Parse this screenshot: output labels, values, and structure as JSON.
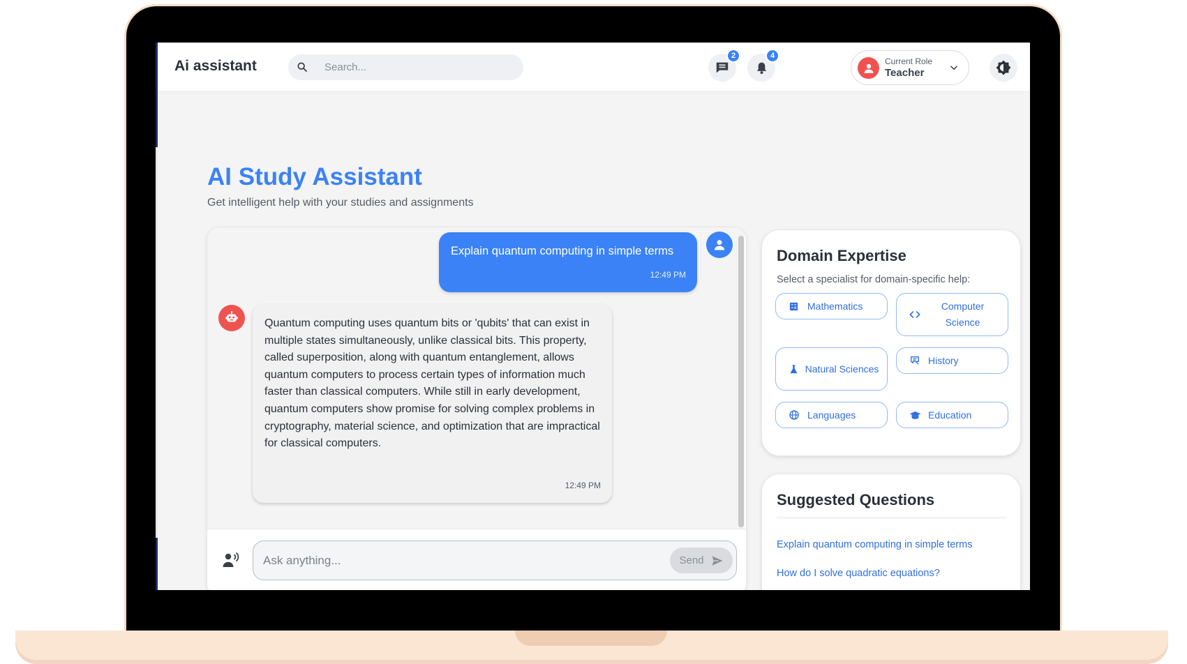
{
  "header": {
    "brand": "Ai assistant",
    "search_placeholder": "Search...",
    "messages_badge": "2",
    "notifications_badge": "4",
    "role_label": "Current Role",
    "role_value": "Teacher"
  },
  "page": {
    "title": "AI Study Assistant",
    "subtitle": "Get intelligent help with your studies and assignments"
  },
  "chat": {
    "messages": [
      {
        "sender": "user",
        "text": "Explain quantum computing in simple terms",
        "time": "12:49 PM"
      },
      {
        "sender": "assistant",
        "text": "Quantum computing uses quantum bits or 'qubits' that can exist in multiple states simultaneously, unlike classical bits. This property, called superposition, along with quantum entanglement, allows quantum computers to process certain types of information much faster than classical computers. While still in early development, quantum computers show promise for solving complex problems in cryptography, material science, and optimization that are impractical for classical computers.",
        "time": "12:49 PM"
      }
    ],
    "input_placeholder": "Ask anything...",
    "send_label": "Send"
  },
  "domain_expertise": {
    "title": "Domain Expertise",
    "subtitle": "Select a specialist for domain-specific help:",
    "domains": [
      {
        "label": "Mathematics",
        "icon": "calculator-icon"
      },
      {
        "label": "Computer Science",
        "icon": "code-icon"
      },
      {
        "label": "Natural Sciences",
        "icon": "flask-icon"
      },
      {
        "label": "History",
        "icon": "history-book-icon"
      },
      {
        "label": "Languages",
        "icon": "globe-icon"
      },
      {
        "label": "Education",
        "icon": "graduation-cap-icon"
      }
    ]
  },
  "suggested_questions": {
    "title": "Suggested Questions",
    "items": [
      "Explain quantum computing in simple terms",
      "How do I solve quadratic equations?"
    ]
  },
  "colors": {
    "accent": "#3b82f6",
    "bot_avatar": "#ef5350",
    "laptop_frame": "#fbe6d4"
  }
}
